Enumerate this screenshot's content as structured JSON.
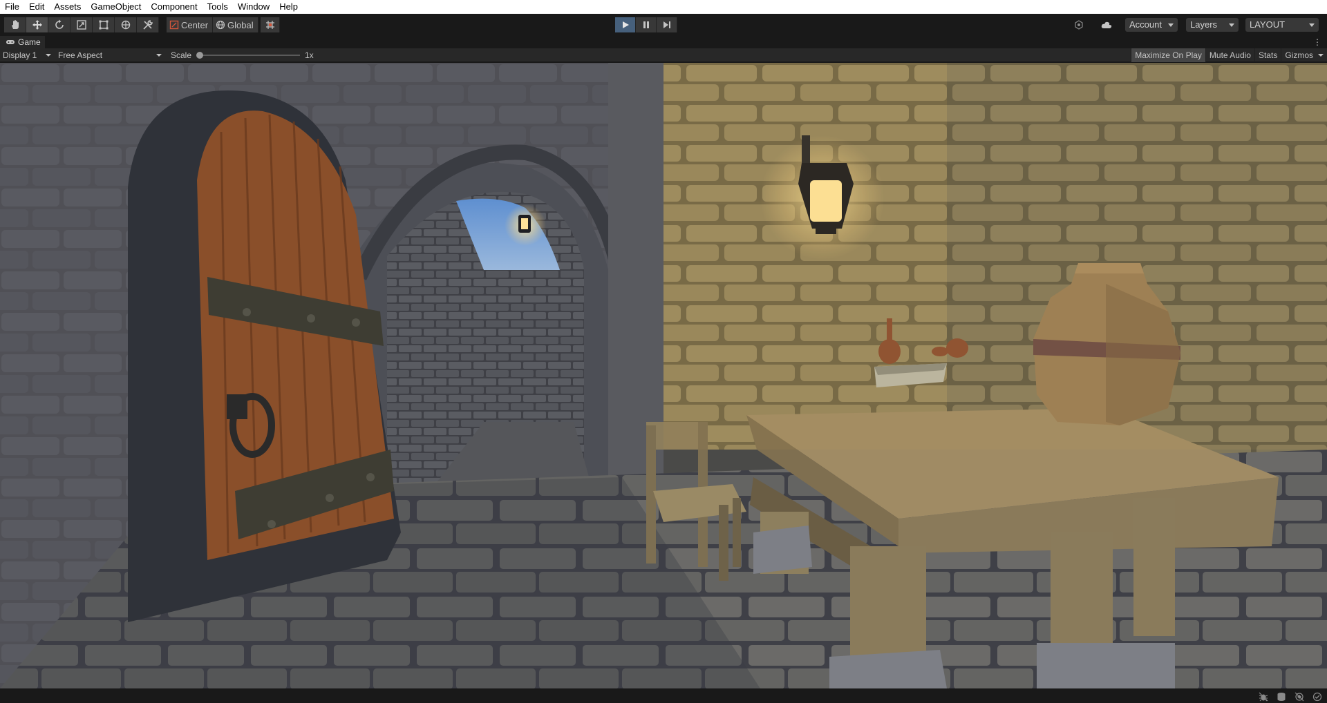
{
  "menubar": {
    "items": [
      "File",
      "Edit",
      "Assets",
      "GameObject",
      "Component",
      "Tools",
      "Window",
      "Help"
    ]
  },
  "toolbar": {
    "tools": [
      "hand-tool-icon",
      "move-tool-icon",
      "rotate-tool-icon",
      "scale-tool-icon",
      "rect-tool-icon",
      "transform-tool-icon",
      "custom-tools-icon"
    ],
    "active_tool": "move-tool-icon",
    "pivot_mode": "Center",
    "pivot_rotation": "Global",
    "playing": true,
    "account_label": "Account",
    "layers_label": "Layers",
    "layout_label": "LAYOUT",
    "accent": "#46607c"
  },
  "game_tab": {
    "title": "Game"
  },
  "game_bar": {
    "display": "Display 1",
    "aspect": "Free Aspect",
    "scale_label": "Scale",
    "scale_value": "1x",
    "scale_fraction": 0,
    "maximize_on_play": "Maximize On Play",
    "mute_audio": "Mute Audio",
    "stats": "Stats",
    "gizmos": "Gizmos",
    "maximize_on_play_enabled": true
  },
  "scene": {
    "description_icons": [
      "wooden-door",
      "stone-arch",
      "wall-lantern",
      "chair",
      "table",
      "book",
      "potion",
      "clay-jar"
    ]
  },
  "statusbar": {
    "icons": [
      "debug-icon",
      "cache-icon",
      "collab-icon",
      "check-icon"
    ]
  }
}
